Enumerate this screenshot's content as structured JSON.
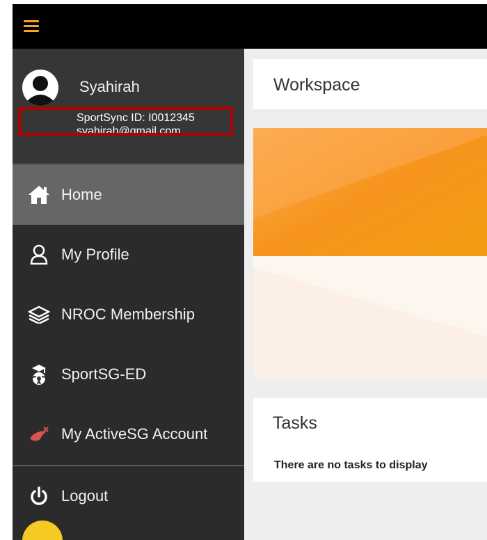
{
  "topbar": {
    "menu_icon": "hamburger-menu-icon",
    "accent_color": "#f5a623"
  },
  "user": {
    "name": "Syahirah",
    "sportsync_id": "SportSync ID: I0012345",
    "email": "syahirah@gmail.com",
    "avatar_icon": "user-avatar-icon"
  },
  "nav": {
    "items": [
      {
        "label": "Home",
        "icon": "home-icon",
        "active": true
      },
      {
        "label": "My Profile",
        "icon": "user-outline-icon"
      },
      {
        "label": "NROC Membership",
        "icon": "layers-icon"
      },
      {
        "label": "SportSG-ED",
        "icon": "graduate-ball-icon"
      },
      {
        "label": "My ActiveSG Account",
        "icon": "activesg-logo-icon"
      }
    ],
    "logout": {
      "label": "Logout",
      "icon": "power-icon"
    }
  },
  "workspace": {
    "title": "Workspace"
  },
  "tasks": {
    "title": "Tasks",
    "empty_message": "There are no tasks to display"
  },
  "colors": {
    "sidebar_bg": "#2b2b2b",
    "active_item_bg": "#666666",
    "highlight_border": "#b30000",
    "banner_orange": "#f7941d"
  }
}
